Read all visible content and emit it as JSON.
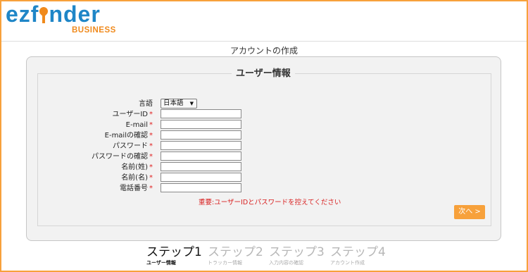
{
  "logo": {
    "part1": "ezf",
    "part2": "nder",
    "sub": "BUSINESS"
  },
  "page": {
    "title": "アカウントの作成"
  },
  "form": {
    "legend": "ユーザー情報",
    "language": {
      "label": "言語",
      "selected": "日本語"
    },
    "fields": [
      {
        "label": "ユーザーID",
        "required": "*",
        "value": ""
      },
      {
        "label": "E-mail",
        "required": "*",
        "value": ""
      },
      {
        "label": "E-mailの確認",
        "required": "*",
        "value": ""
      },
      {
        "label": "パスワード",
        "required": "*",
        "value": ""
      },
      {
        "label": "パスワードの確認",
        "required": "*",
        "value": ""
      },
      {
        "label": "名前(姓)",
        "required": "*",
        "value": ""
      },
      {
        "label": "名前(名)",
        "required": "*",
        "value": ""
      },
      {
        "label": "電話番号",
        "required": "*",
        "value": ""
      }
    ],
    "notice": "重要:ユーザーIDとパスワードを控えてください",
    "next_label": "次へ >"
  },
  "steps": [
    {
      "title": "ステップ1",
      "subtitle": "ユーザー情報",
      "active": true
    },
    {
      "title": "ステップ2",
      "subtitle": "トラッカー情報",
      "active": false
    },
    {
      "title": "ステップ3",
      "subtitle": "入力内容の確認",
      "active": false
    },
    {
      "title": "ステップ4",
      "subtitle": "アカウント作成",
      "active": false
    }
  ],
  "colors": {
    "accent": "#f7a13b",
    "brand_blue": "#1f86c7",
    "required": "#e02020"
  }
}
